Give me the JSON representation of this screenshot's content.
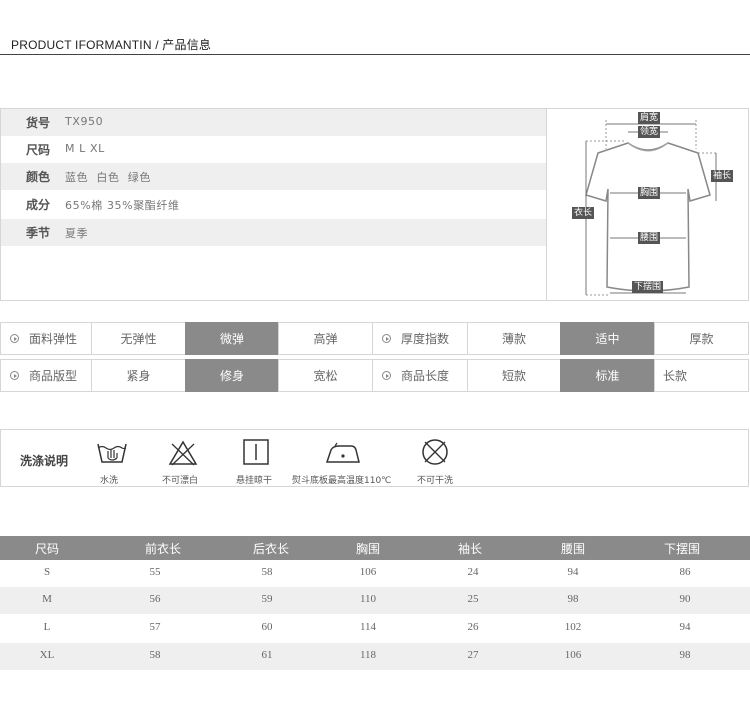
{
  "header": {
    "title": "PRODUCT IFORMANTIN / 产品信息"
  },
  "info": [
    {
      "key": "货号",
      "value": "TX950"
    },
    {
      "key": "尺码",
      "value": "M L XL"
    },
    {
      "key": "颜色",
      "value": "蓝色  白色  绿色"
    },
    {
      "key": "成分",
      "value": "65%棉 35%聚酯纤维"
    },
    {
      "key": "季节",
      "value": "夏季"
    }
  ],
  "diagram": {
    "shoulder": "肩宽",
    "collar": "领宽",
    "sleeve": "袖长",
    "chest": "胸围",
    "length": "衣长",
    "waist": "腰围",
    "hem": "下摆围"
  },
  "attributes": {
    "row1": {
      "label1": "面料弹性",
      "opt1": [
        "无弹性",
        "微弹",
        "高弹"
      ],
      "label2": "厚度指数",
      "opt2": [
        "薄款",
        "适中",
        "厚款"
      ]
    },
    "row2": {
      "label1": "商品版型",
      "opt1": [
        "紧身",
        "修身",
        "宽松"
      ],
      "label2": "商品长度",
      "opt2": [
        "短款",
        "标准",
        "长款"
      ]
    },
    "selected_color": "#8a8a8a"
  },
  "wash": {
    "title": "洗涤说明",
    "items": [
      {
        "icon": "hand-wash-icon",
        "label": "水洗"
      },
      {
        "icon": "no-bleach-icon",
        "label": "不可漂白"
      },
      {
        "icon": "hang-dry-icon",
        "label": "悬挂晾干"
      },
      {
        "icon": "iron-icon",
        "label": "熨斗底板最高温度110℃"
      },
      {
        "icon": "no-tumble-dry-icon",
        "label": "不可干洗"
      }
    ]
  },
  "size_table": {
    "headers": [
      "尺码",
      "前衣长",
      "后衣长",
      "胸围",
      "袖长",
      "腰围",
      "下摆围"
    ],
    "rows": [
      [
        "S",
        "55",
        "58",
        "106",
        "24",
        "94",
        "86"
      ],
      [
        "M",
        "56",
        "59",
        "110",
        "25",
        "98",
        "90"
      ],
      [
        "L",
        "57",
        "60",
        "114",
        "26",
        "102",
        "94"
      ],
      [
        "XL",
        "58",
        "61",
        "118",
        "27",
        "106",
        "98"
      ]
    ]
  }
}
